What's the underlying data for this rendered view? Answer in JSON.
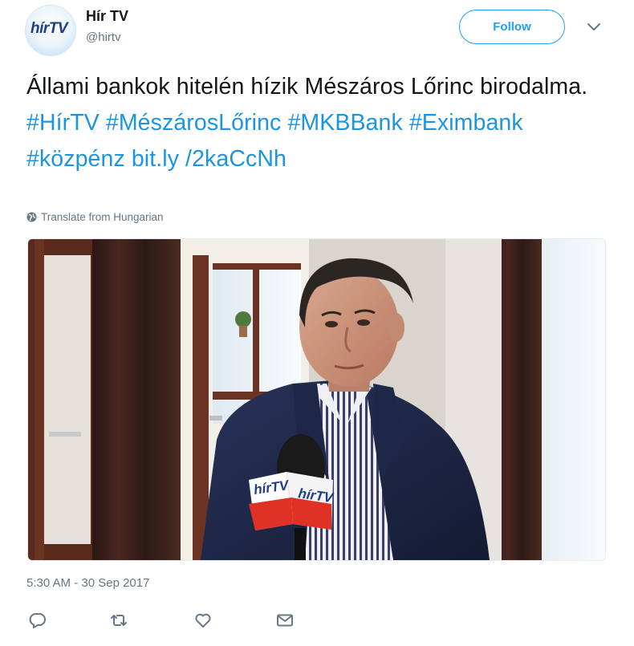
{
  "account": {
    "display_name": "Hír TV",
    "handle": "@hirtv",
    "avatar_logo_text": "hírTV"
  },
  "follow_button": {
    "label": "Follow"
  },
  "tweet": {
    "text_parts": [
      {
        "text": "Állami bankok hitelén hízik Mészáros Lőrinc birodalma. ",
        "link": false
      },
      {
        "text": "#HírTV",
        "link": true
      },
      {
        "text": " ",
        "link": false
      },
      {
        "text": "#MészárosLőrinc",
        "link": true
      },
      {
        "text": " ",
        "link": false
      },
      {
        "text": "#MKBBank",
        "link": true
      },
      {
        "text": " ",
        "link": false
      },
      {
        "text": "#Eximbank",
        "link": true
      },
      {
        "text": " ",
        "link": false
      },
      {
        "text": "#közpénz",
        "link": true
      },
      {
        "text": " ",
        "link": false
      },
      {
        "text": "bit.ly /2kaCcNh",
        "link": true
      }
    ],
    "translate_label": "Translate from Hungarian",
    "timestamp": "5:30 AM - 30 Sep 2017"
  },
  "media": {
    "mic_flag_text": "hírTV"
  },
  "actions": [
    {
      "name": "reply-button",
      "icon": "reply-icon"
    },
    {
      "name": "retweet-button",
      "icon": "retweet-icon"
    },
    {
      "name": "like-button",
      "icon": "heart-icon"
    },
    {
      "name": "direct-message-button",
      "icon": "envelope-icon"
    }
  ],
  "colors": {
    "link": "#1b95e0",
    "follow": "#1da1f2",
    "muted": "#657786",
    "text": "#14171a"
  }
}
